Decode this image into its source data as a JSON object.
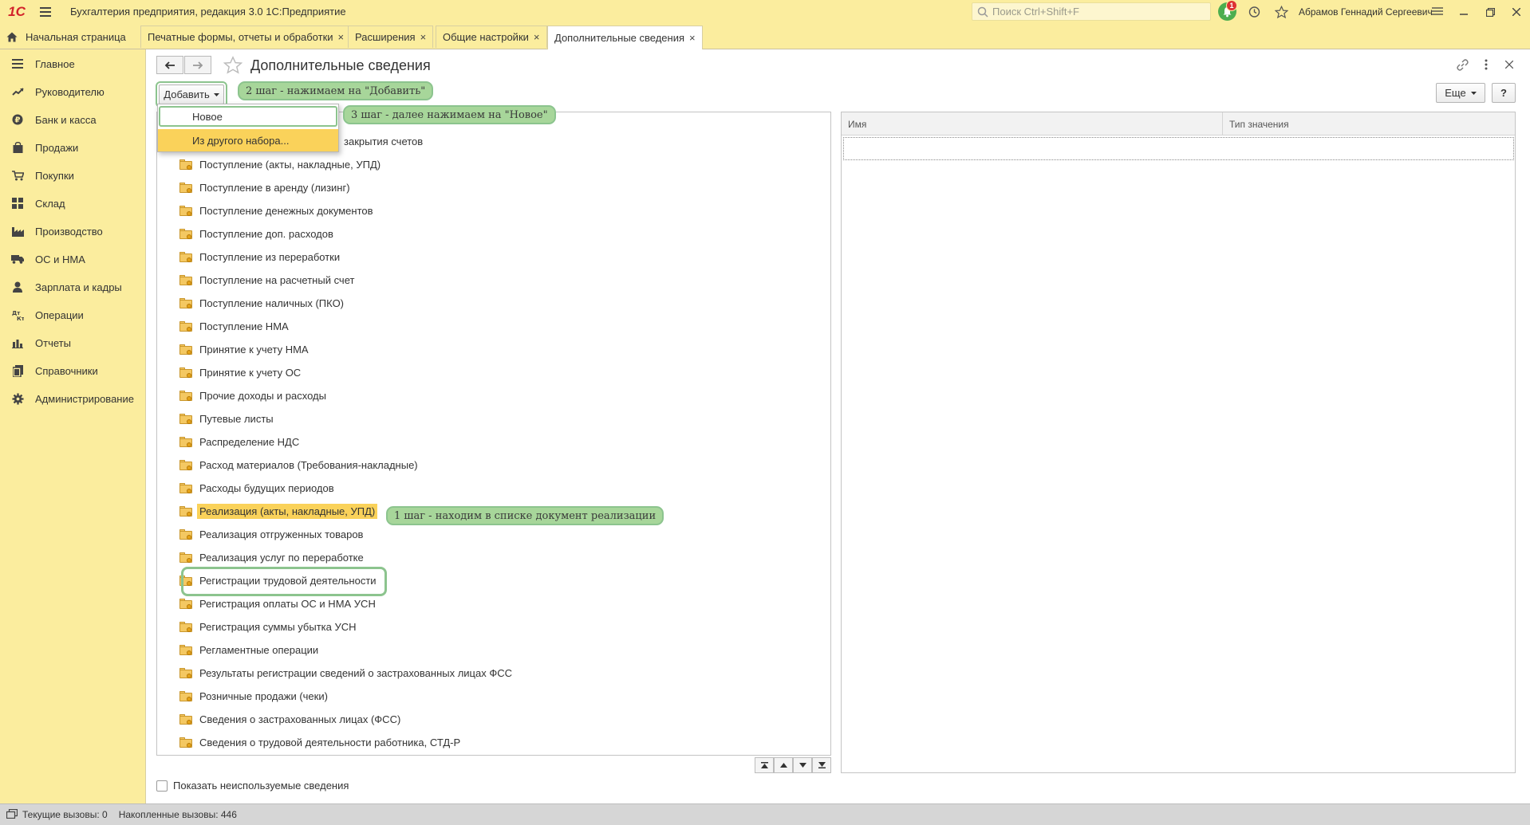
{
  "app": {
    "logo": "1С",
    "title": "Бухгалтерия предприятия, редакция 3.0 1С:Предприятие",
    "search_placeholder": "Поиск Ctrl+Shift+F",
    "notifications_count": "1",
    "user_name": "Абрамов Геннадий Сергеевич"
  },
  "tabs": {
    "home": "Начальная страница",
    "items": [
      {
        "label": "Печатные формы, отчеты и обработки"
      },
      {
        "label": "Расширения"
      },
      {
        "label": "Общие настройки"
      },
      {
        "label": "Дополнительные сведения"
      }
    ],
    "close_glyph": "×"
  },
  "sidebar": {
    "items": [
      {
        "label": "Главное",
        "icon": "menu-lines-icon"
      },
      {
        "label": "Руководителю",
        "icon": "trend-icon"
      },
      {
        "label": "Банк и касса",
        "icon": "ruble-icon"
      },
      {
        "label": "Продажи",
        "icon": "bag-icon"
      },
      {
        "label": "Покупки",
        "icon": "cart-icon"
      },
      {
        "label": "Склад",
        "icon": "warehouse-icon"
      },
      {
        "label": "Производство",
        "icon": "factory-icon"
      },
      {
        "label": "ОС и НМА",
        "icon": "truck-icon"
      },
      {
        "label": "Зарплата и кадры",
        "icon": "person-icon"
      },
      {
        "label": "Операции",
        "icon": "dt-kt-icon"
      },
      {
        "label": "Отчеты",
        "icon": "bar-chart-icon"
      },
      {
        "label": "Справочники",
        "icon": "books-icon"
      },
      {
        "label": "Администрирование",
        "icon": "gear-icon"
      }
    ]
  },
  "page": {
    "title": "Дополнительные сведения",
    "add_button": "Добавить",
    "more_button": "Еще",
    "help_button": "?"
  },
  "dropdown": {
    "new": "Новое",
    "from_other": "Из другого набора..."
  },
  "annotations": {
    "step1": "1 шаг - находим в списке документ реализации",
    "step2": "2 шаг - нажимаем на \"Добавить\"",
    "step3": "3 шаг - далее нажимаем на \"Новое\""
  },
  "list": {
    "partial_first": "закрытия счетов",
    "items": [
      "Поступление (акты, накладные, УПД)",
      "Поступление в аренду (лизинг)",
      "Поступление денежных документов",
      "Поступление доп. расходов",
      "Поступление из переработки",
      "Поступление на расчетный счет",
      "Поступление наличных (ПКО)",
      "Поступление НМА",
      "Принятие к учету НМА",
      "Принятие к учету ОС",
      "Прочие доходы и расходы",
      "Путевые листы",
      "Распределение НДС",
      "Расход материалов (Требования-накладные)",
      "Расходы будущих периодов",
      "Реализация (акты, накладные, УПД)",
      "Реализация отгруженных товаров",
      "Реализация услуг по переработке",
      "Регистрации трудовой деятельности",
      "Регистрация оплаты ОС и НМА УСН",
      "Регистрация суммы убытка УСН",
      "Регламентные операции",
      "Результаты регистрации сведений о застрахованных лицах ФСС",
      "Розничные продажи (чеки)",
      "Сведения о застрахованных лицах (ФСС)",
      "Сведения о трудовой деятельности работника, СТД-Р"
    ],
    "selected_index": 15,
    "show_unused": "Показать неиспользуемые сведения"
  },
  "right_table": {
    "columns": [
      "Имя",
      "Тип значения"
    ]
  },
  "status": {
    "current_calls": "Текущие вызовы: 0",
    "accumulated_calls": "Накопленные вызовы: 446"
  }
}
